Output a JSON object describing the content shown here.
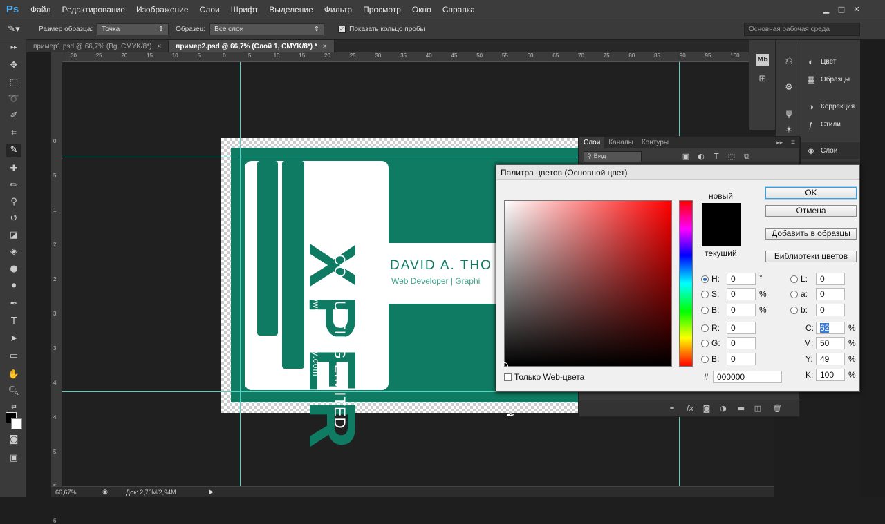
{
  "app": {
    "logo": "Ps"
  },
  "menu": [
    "Файл",
    "Редактирование",
    "Изображение",
    "Слои",
    "Шрифт",
    "Выделение",
    "Фильтр",
    "Просмотр",
    "Окно",
    "Справка"
  ],
  "window_buttons": {
    "minimize": "▁",
    "maximize": "□",
    "close": "✕"
  },
  "options": {
    "sample_size_label": "Размер образца:",
    "sample_size_value": "Точка",
    "sample_label": "Образец:",
    "sample_value": "Все слои",
    "show_ring_label": "Показать кольцо пробы",
    "show_ring_checked": true,
    "workspace": "Основная рабочая среда"
  },
  "tabs": [
    {
      "label": "пример1.psd @ 66,7% (Bg, CMYK/8*)",
      "close": "×",
      "active": false
    },
    {
      "label": "пример2.psd @ 66,7% (Слой 1, CMYK/8*) *",
      "close": "×",
      "active": true
    }
  ],
  "ruler_top_ticks": [
    "30",
    "25",
    "20",
    "15",
    "10",
    "5",
    "0",
    "5",
    "10",
    "15",
    "20",
    "25",
    "30",
    "35",
    "40",
    "45",
    "50",
    "55",
    "60",
    "65",
    "70",
    "75",
    "80",
    "85",
    "90",
    "95",
    "100"
  ],
  "ruler_left_ticks": [
    "0",
    "5",
    "1",
    "2",
    "2",
    "3",
    "3",
    "4",
    "4",
    "5",
    "5",
    "6"
  ],
  "card": {
    "brand": "XPER",
    "subtitle": "CONSULTING LIMITED",
    "website": "www.company.com",
    "name": "DAVID A. THO",
    "title": "Web Developer  |  Graphi",
    "color": "#0e7b62"
  },
  "right_panels": [
    {
      "label": "Цвет",
      "icon": "color-wheel-icon"
    },
    {
      "label": "Образцы",
      "icon": "swatches-grid-icon"
    },
    {
      "label": "Коррекция",
      "icon": "adjustments-icon"
    },
    {
      "label": "Стили",
      "icon": "fx-styles-icon"
    },
    {
      "label": "Слои",
      "icon": "layers-icon"
    }
  ],
  "layers_panel": {
    "tabs": [
      "Слои",
      "Каналы",
      "Контуры"
    ],
    "filter_label": "Вид",
    "collapse": "▸▸",
    "menu": "≡"
  },
  "picker": {
    "title": "Палитра цветов (Основной цвет)",
    "new_label": "новый",
    "current_label": "текущий",
    "ok": "OK",
    "cancel": "Отмена",
    "add_swatch": "Добавить в образцы",
    "libraries": "Библиотеки цветов",
    "web_only_label": "Только Web-цвета",
    "fields": {
      "H": {
        "label": "H:",
        "value": "0",
        "unit": "°"
      },
      "S": {
        "label": "S:",
        "value": "0",
        "unit": "%"
      },
      "B": {
        "label": "B:",
        "value": "0",
        "unit": "%"
      },
      "R": {
        "label": "R:",
        "value": "0"
      },
      "G": {
        "label": "G:",
        "value": "0"
      },
      "Bb": {
        "label": "B:",
        "value": "0"
      },
      "L": {
        "label": "L:",
        "value": "0"
      },
      "a": {
        "label": "a:",
        "value": "0"
      },
      "b": {
        "label": "b:",
        "value": "0"
      },
      "C": {
        "label": "C:",
        "value": "62",
        "unit": "%"
      },
      "M": {
        "label": "M:",
        "value": "50",
        "unit": "%"
      },
      "Y": {
        "label": "Y:",
        "value": "49",
        "unit": "%"
      },
      "K": {
        "label": "K:",
        "value": "100",
        "unit": "%"
      },
      "hex_label": "#",
      "hex": "000000"
    },
    "selected_mode": "H"
  },
  "status": {
    "zoom": "66,67%",
    "doc": "Док: 2,70M/2,94M",
    "arrow": "▶"
  },
  "colors": {
    "guide": "#4fd6c7",
    "accent": "#0e7b62",
    "highlight": "#36a0e0"
  }
}
